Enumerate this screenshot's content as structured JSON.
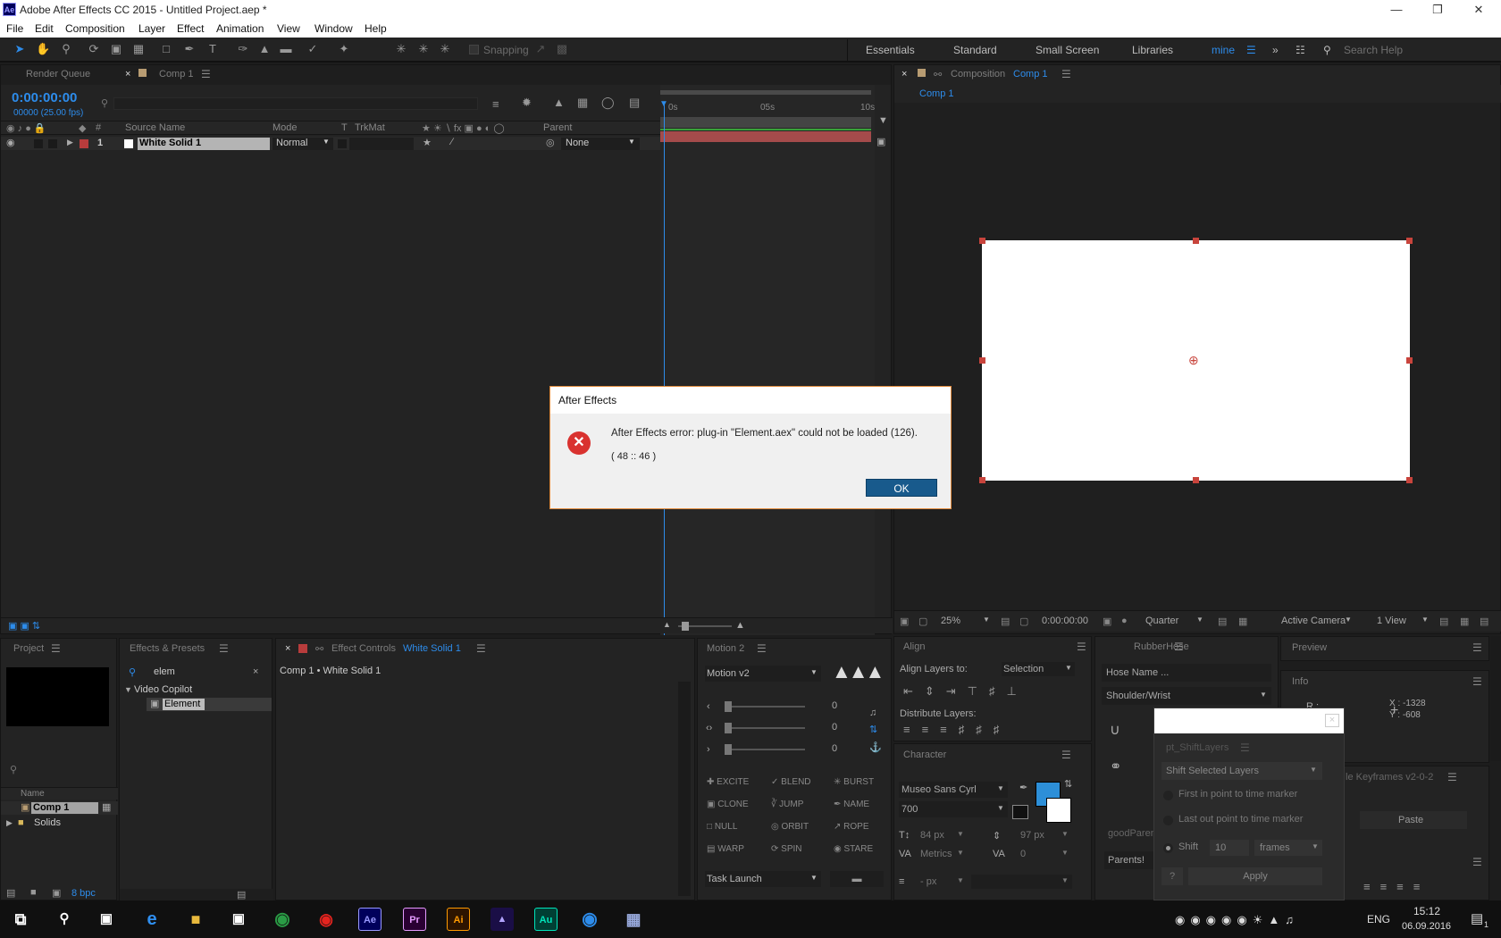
{
  "app": {
    "title": "Adobe After Effects CC 2015 - Untitled Project.aep *",
    "logo": "Ae"
  },
  "window_controls": {
    "minimize_icon": "minimize-icon",
    "restore_icon": "restore-icon",
    "close_icon": "close-icon"
  },
  "menu": [
    "File",
    "Edit",
    "Composition",
    "Layer",
    "Effect",
    "Animation",
    "View",
    "Window",
    "Help"
  ],
  "toolbar": {
    "snapping_label": "Snapping",
    "workspaces": [
      "Essentials",
      "Standard",
      "Small Screen",
      "Libraries",
      "mine"
    ],
    "search_placeholder": "Search Help"
  },
  "timeline": {
    "tab_render_queue": "Render Queue",
    "tab_comp": "Comp 1",
    "timecode": "0:00:00:00",
    "fps": "00000 (25.00 fps)",
    "col_num": "#",
    "col_source": "Source Name",
    "col_mode": "Mode",
    "col_t": "T",
    "col_trkmat": "TrkMat",
    "col_parent": "Parent",
    "ruler": [
      "0s",
      "05s",
      "10s"
    ],
    "layer": {
      "index": "1",
      "name": "White Solid 1",
      "mode": "Normal",
      "parent": "None",
      "label_color": "#b83c3c"
    }
  },
  "composition": {
    "tab_prefix": "Composition",
    "tab_name": "Comp 1",
    "crumb": "Comp 1",
    "zoom": "25%",
    "timecode": "0:00:00:00",
    "resolution": "Quarter",
    "camera": "Active Camera",
    "views": "1 View"
  },
  "dialog": {
    "title": "After Effects",
    "message": "After Effects error: plug-in \"Element.aex\" could not be loaded (126).",
    "code": "( 48 :: 46 )",
    "ok_label": "OK"
  },
  "project": {
    "tab": "Project",
    "col_name": "Name",
    "items": [
      "Comp 1",
      "Solids"
    ],
    "bpc": "8 bpc"
  },
  "effects_presets": {
    "tab": "Effects & Presets",
    "search_value": "elem",
    "category": "Video Copilot",
    "item": "Element"
  },
  "effect_controls": {
    "tab_prefix": "Effect Controls",
    "tab_name": "White Solid 1",
    "crumb": "Comp 1 • White Solid 1"
  },
  "motion": {
    "tab": "Motion 2",
    "preset": "Motion v2",
    "slider_values": [
      "0",
      "0",
      "0"
    ],
    "buttons": [
      "EXCITE",
      "BLEND",
      "BURST",
      "CLONE",
      "JUMP",
      "NAME",
      "NULL",
      "ORBIT",
      "ROPE",
      "WARP",
      "SPIN",
      "STARE"
    ],
    "task": "Task Launch"
  },
  "align": {
    "tab": "Align",
    "align_to_label": "Align Layers to:",
    "align_to_value": "Selection",
    "distribute_label": "Distribute Layers:"
  },
  "character": {
    "tab": "Character",
    "font": "Museo Sans Cyrl",
    "weight": "700",
    "size": "84 px",
    "leading": "97 px",
    "kerning": "Metrics",
    "tracking": "0",
    "stroke": "- px",
    "fill_color": "#2d8fd8"
  },
  "rubberhose": {
    "tab": "RubberHose",
    "name_placeholder": "Hose Name ...",
    "preset": "Shoulder/Wrist",
    "good_parents": "goodParents",
    "parents_btn": "Parents!"
  },
  "preview": {
    "tab": "Preview"
  },
  "info": {
    "tab": "Info",
    "r": "R :",
    "x": "X : -1328",
    "y": "Y : -608"
  },
  "shift_layers": {
    "tab": "pt_ShiftLayers",
    "mode": "Shift Selected Layers",
    "opt1": "First in point to time marker",
    "opt2": "Last out point to time marker",
    "opt3": "Shift",
    "shift_value": "10",
    "unit": "frames",
    "help": "?",
    "apply": "Apply"
  },
  "keyframes": {
    "tab": "le Keyframes v2-0-2",
    "paste": "Paste"
  },
  "taskbar": {
    "lang": "ENG",
    "time": "15:12",
    "date": "06.09.2016",
    "notifications": "1"
  }
}
